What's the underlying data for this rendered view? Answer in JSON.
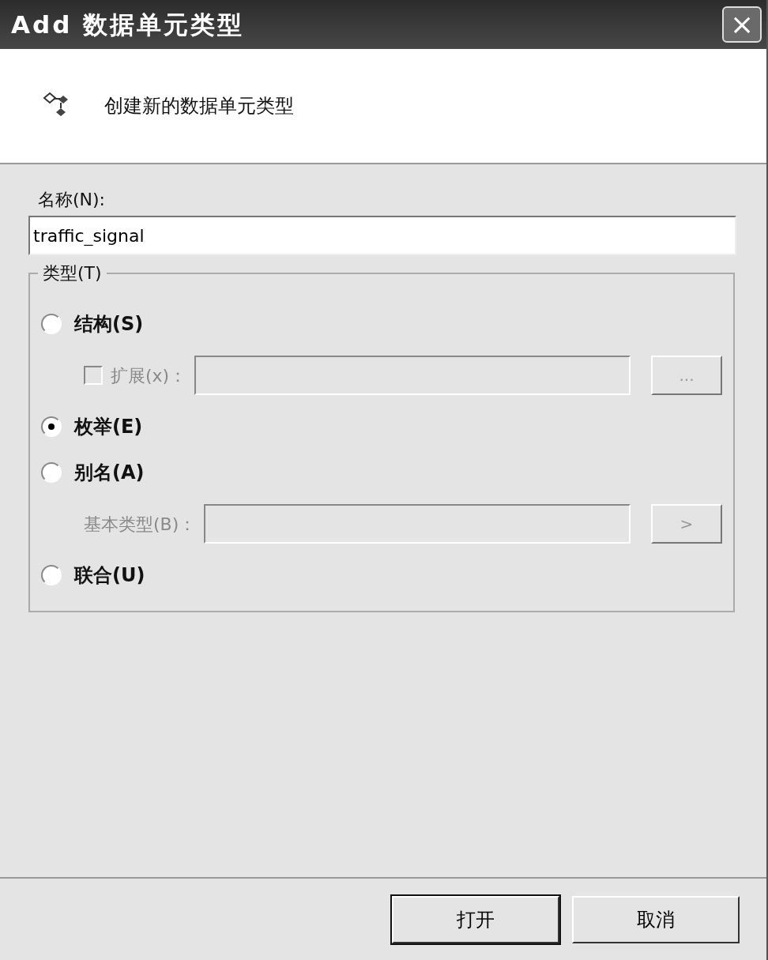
{
  "window": {
    "title": "Add 数据单元类型",
    "close_button": "×"
  },
  "header": {
    "text": "创建新的数据单元类型"
  },
  "name_field": {
    "label": "名称(N):",
    "value": "traffic_signal"
  },
  "type_group": {
    "label": "类型(T)",
    "options": [
      {
        "label": "结构(S)",
        "selected": false,
        "extension": {
          "label": "扩展(x)：",
          "checked": false,
          "disabled": true,
          "button": "..."
        }
      },
      {
        "label": "枚举(E)",
        "selected": true
      },
      {
        "label": "别名(A)",
        "selected": false,
        "base_type": {
          "label": "基本类型(B)：",
          "disabled": true,
          "button": ">"
        }
      },
      {
        "label": "联合(U)",
        "selected": false
      }
    ]
  },
  "buttons": [
    {
      "label": "打开",
      "default": true
    },
    {
      "label": "取消",
      "default": false
    }
  ]
}
